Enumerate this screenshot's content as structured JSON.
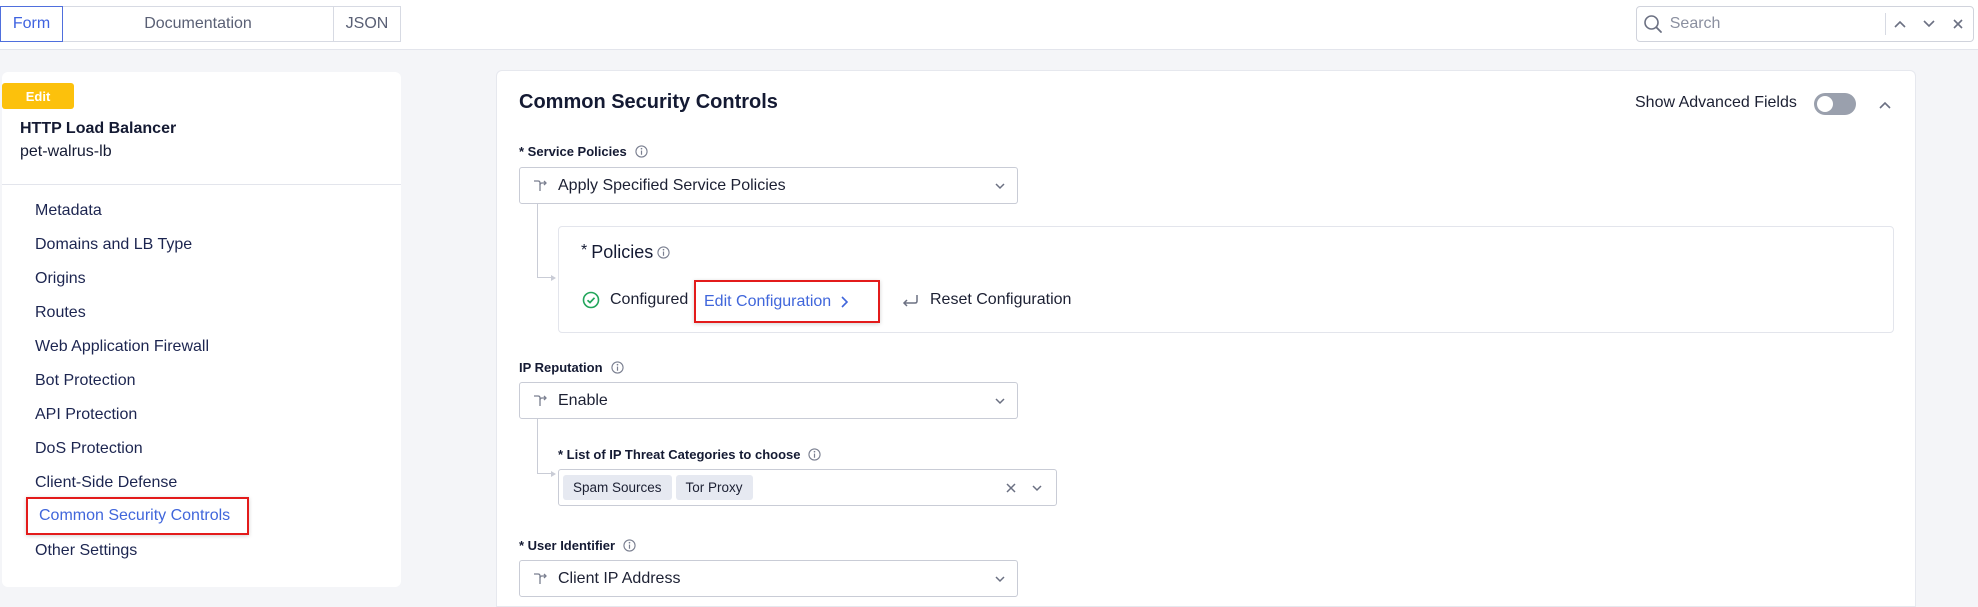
{
  "toolbar": {
    "tabs": [
      {
        "label": "Form",
        "active": true
      },
      {
        "label": "Documentation",
        "active": false
      },
      {
        "label": "JSON",
        "active": false
      }
    ],
    "search": {
      "placeholder": "Search",
      "value": ""
    }
  },
  "sidebar": {
    "badge": "Edit",
    "object_type": "HTTP Load Balancer",
    "object_name": "pet-walrus-lb",
    "items": [
      {
        "label": "Metadata"
      },
      {
        "label": "Domains and LB Type"
      },
      {
        "label": "Origins"
      },
      {
        "label": "Routes"
      },
      {
        "label": "Web Application Firewall"
      },
      {
        "label": "Bot Protection"
      },
      {
        "label": "API Protection"
      },
      {
        "label": "DoS Protection"
      },
      {
        "label": "Client-Side Defense"
      },
      {
        "label": "Common Security Controls"
      },
      {
        "label": "Other Settings"
      }
    ],
    "active_item": "Common Security Controls"
  },
  "main": {
    "section_title": "Common Security Controls",
    "show_advanced_label": "Show Advanced Fields",
    "show_advanced_enabled": false,
    "service_policies": {
      "label": "* Service Policies",
      "value": "Apply Specified Service Policies",
      "policies": {
        "title_star": "*",
        "title": "Policies",
        "status": "Configured",
        "edit_label": "Edit Configuration",
        "reset_label": "Reset Configuration"
      }
    },
    "ip_reputation": {
      "label": "IP Reputation",
      "value": "Enable",
      "threat_categories": {
        "label": "* List of IP Threat Categories to choose",
        "chips": [
          "Spam Sources",
          "Tor Proxy"
        ]
      }
    },
    "user_identifier": {
      "label": "* User Identifier",
      "value": "Client IP Address"
    }
  },
  "colors": {
    "accent": "#4066db",
    "badge": "#fcc10c",
    "highlight_border": "#e31b1b",
    "success": "#22a55b"
  }
}
